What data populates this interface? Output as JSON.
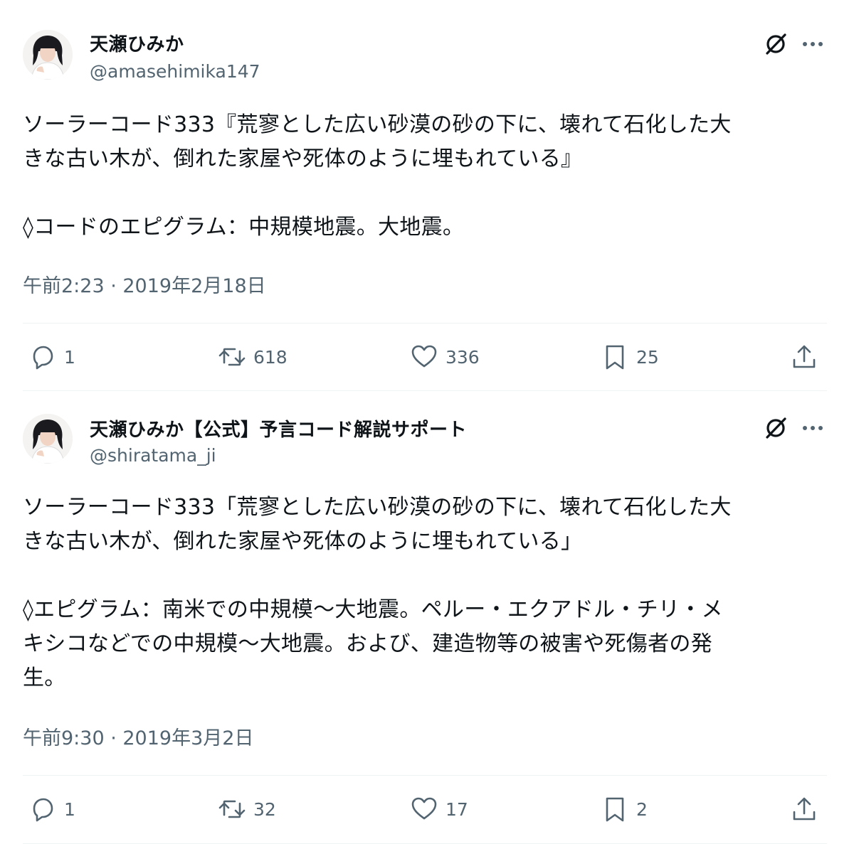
{
  "tweets": [
    {
      "display_name": "天瀬ひみか",
      "handle": "@amasehimika147",
      "text": "ソーラーコード333『荒寥とした広い砂漠の砂の下に、壊れて石化した大\nきな古い木が、倒れた家屋や死体のように埋もれている』\n\n◊コードのエピグラム：中規模地震。大地震。",
      "timestamp": "午前2:23 · 2019年2月18日",
      "replies": "1",
      "retweets": "618",
      "likes": "336",
      "bookmarks": "25"
    },
    {
      "display_name": "天瀬ひみか【公式】予言コード解説サポート",
      "handle": "@shiratama_ji",
      "text": "ソーラーコード333「荒寥とした広い砂漠の砂の下に、壊れて石化した大\nきな古い木が、倒れた家屋や死体のように埋もれている」\n\n◊エピグラム：南米での中規模〜大地震。ペルー・エクアドル・チリ・メ\nキシコなどでの中規模〜大地震。および、建造物等の被害や死傷者の発\n生。",
      "timestamp": "午前9:30 · 2019年3月2日",
      "replies": "1",
      "retweets": "32",
      "likes": "17",
      "bookmarks": "2"
    }
  ],
  "icons": {
    "grok": "grok-icon",
    "more": "more-icon",
    "reply": "reply-icon",
    "retweet": "retweet-icon",
    "like": "heart-icon",
    "bookmark": "bookmark-icon",
    "share": "share-icon"
  },
  "colors": {
    "text": "#0f1419",
    "secondary": "#536471",
    "divider": "#eff3f4"
  }
}
